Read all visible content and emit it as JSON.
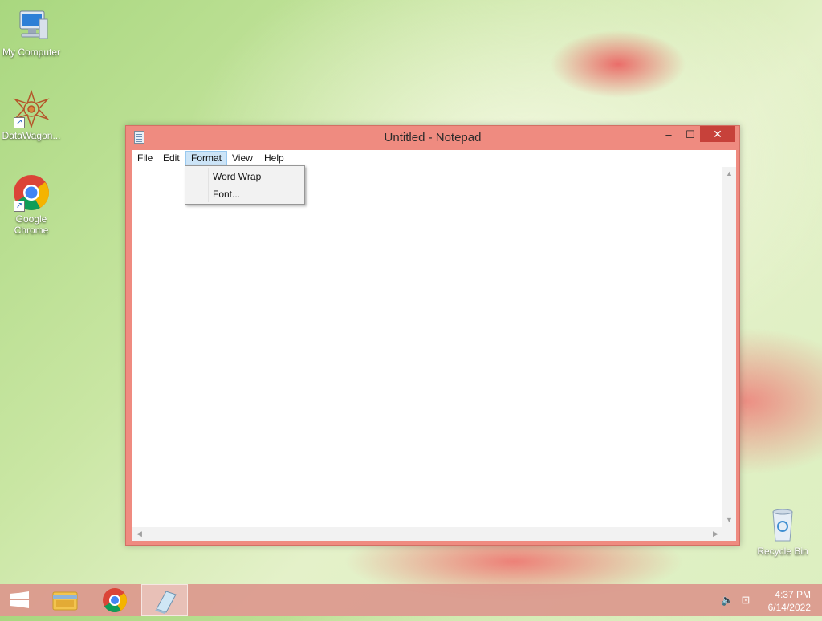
{
  "desktop": {
    "icons": [
      {
        "label": "My Computer",
        "icon": "computer-icon"
      },
      {
        "label": "DataWagon...",
        "icon": "datawagon-icon"
      },
      {
        "label": "Google Chrome",
        "icon": "chrome-icon"
      },
      {
        "label": "Recycle Bin",
        "icon": "recycle-bin-icon"
      }
    ]
  },
  "window": {
    "title": "Untitled - Notepad",
    "minimize_label": "‒",
    "maximize_label": "☐",
    "close_label": "✕",
    "menu": [
      "File",
      "Edit",
      "Format",
      "View",
      "Help"
    ],
    "active_menu": "Format",
    "content": ""
  },
  "format_menu": {
    "items": [
      "Word Wrap",
      "Font..."
    ]
  },
  "taskbar": {
    "time": "4:37 PM",
    "date": "6/14/2022",
    "buttons": [
      "start-button",
      "file-explorer-button",
      "chrome-button",
      "notepad-button"
    ]
  },
  "colors": {
    "window_frame": "#ef8b80",
    "close_button": "#c7413a",
    "menu_highlight": "#cce4f7",
    "taskbar": "#dc968c"
  }
}
